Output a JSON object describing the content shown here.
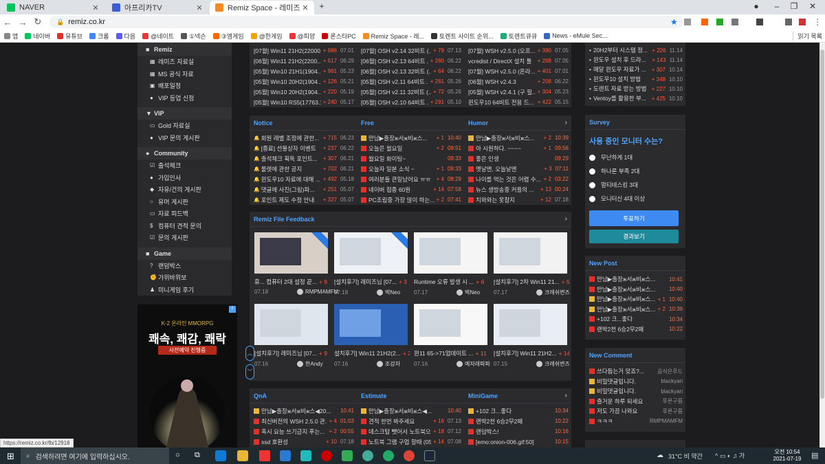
{
  "browser": {
    "tabs": [
      {
        "title": "NAVER",
        "color": "#03c75a"
      },
      {
        "title": "아프리카TV",
        "color": "#3b5ed8"
      },
      {
        "title": "Remiz Space - 레미즈",
        "color": "#f28b20"
      }
    ],
    "url": "remiz.co.kr",
    "bookmarks": [
      {
        "label": "앱",
        "color": "#888"
      },
      {
        "label": "네이버",
        "color": "#03c75a"
      },
      {
        "label": "유튜브",
        "color": "#e52d27"
      },
      {
        "label": "크롬",
        "color": "#4285f4"
      },
      {
        "label": "다음",
        "color": "#5a5aff"
      },
      {
        "label": "@네이트",
        "color": "#e33"
      },
      {
        "label": "①넥슨",
        "color": "#555"
      },
      {
        "label": "③엠게임",
        "color": "#f60"
      },
      {
        "label": "@한게임",
        "color": "#f4a300"
      },
      {
        "label": "@피망",
        "color": "#e33"
      },
      {
        "label": "론스타PC",
        "color": "#c00"
      },
      {
        "label": "Remiz Space - 레...",
        "color": "#f28b20"
      },
      {
        "label": "토렌트 사이트 순위...",
        "color": "#333"
      },
      {
        "label": "토렌트큐큐",
        "color": "#2a7"
      },
      {
        "label": "News - eMule Sec...",
        "color": "#36c"
      }
    ],
    "reading_list": "읽기 목록",
    "status_url": "https://remiz.co.kr/fb/12918"
  },
  "sidebar": {
    "sections": [
      {
        "title": "Remiz",
        "icon": "■",
        "items": [
          {
            "label": "레미즈 자료실",
            "icon": "▦"
          },
          {
            "label": "MS 공식 자료",
            "icon": "▦"
          },
          {
            "label": "배포일정",
            "icon": "▣"
          },
          {
            "label": "VIP 등업 신청",
            "icon": "●"
          }
        ]
      },
      {
        "title": "VIP",
        "icon": "▼",
        "items": [
          {
            "label": "Gold 자료실",
            "icon": "▭"
          },
          {
            "label": "VIP 문의 게시판",
            "icon": "●"
          }
        ]
      },
      {
        "title": "Community",
        "icon": "●",
        "items": [
          {
            "label": "출석체크",
            "icon": "☑"
          },
          {
            "label": "가입인사",
            "icon": "●"
          },
          {
            "label": "자유/건의 게시판",
            "icon": "◆"
          },
          {
            "label": "유머 게시판",
            "icon": "○"
          },
          {
            "label": "자료 피드백",
            "icon": "▭"
          },
          {
            "label": "컴퓨터 견적 문의",
            "icon": "$"
          },
          {
            "label": "문의 게시판",
            "icon": "☑"
          }
        ]
      },
      {
        "title": "Game",
        "icon": "■",
        "items": [
          {
            "label": "랜덤박스",
            "icon": "?"
          },
          {
            "label": "가위바위보",
            "icon": "✊"
          },
          {
            "label": "미니게임 후기",
            "icon": "♟"
          }
        ]
      }
    ]
  },
  "ad": {
    "game": "K-2 온라인 MMORPG",
    "slogan": "쾌속, 쾌감, 쾌락",
    "cta": "사전예약 진행중"
  },
  "top_lists": {
    "col1": [
      {
        "t": "[07월] Win11 21H2(22000...",
        "c": "+ 986",
        "d": "07.01"
      },
      {
        "t": "[06월] Win11 21H2(2200...",
        "c": "+ 617",
        "d": "06.29"
      },
      {
        "t": "[05월] Win10 21H1(1904...",
        "c": "+ 961",
        "d": "05.23"
      },
      {
        "t": "[05월] Win10 20H2(1904...",
        "c": "+ 126",
        "d": "05.21"
      },
      {
        "t": "[05월] Win10 20H2(1904...",
        "c": "+ 220",
        "d": "05.19"
      },
      {
        "t": "[05월] Win10 RS5(17763.1...",
        "c": "+ 240",
        "d": "05.17"
      }
    ],
    "col2": [
      {
        "t": "[07월] OSH v2.14 32비트 (...",
        "c": "+ 79",
        "d": "07.13"
      },
      {
        "t": "[06월] OSH v2.13 64비트 ...",
        "c": "+ 260",
        "d": "06.22"
      },
      {
        "t": "[06월] OSH v2.13 32비트 (...",
        "c": "+ 64",
        "d": "06.22"
      },
      {
        "t": "[05월] OSH v2.11 64비트 ...",
        "c": "+ 261",
        "d": "05.26"
      },
      {
        "t": "[05월] OSH v2.11 32비트 (...",
        "c": "+ 72",
        "d": "05.26"
      },
      {
        "t": "[05월] OSH v2.10 64비트 ...",
        "c": "+ 291",
        "d": "05.10"
      }
    ],
    "col3": [
      {
        "t": "[07월] WSH v2.5.0 (오프...",
        "c": "+ 390",
        "d": "07.05"
      },
      {
        "t": "vcredist / DirectX 설치 툴",
        "c": "+ 268",
        "d": "07.05"
      },
      {
        "t": "[07월] WSH v2.5.0 (온라...",
        "c": "+ 401",
        "d": "07.01"
      },
      {
        "t": "[06월] WSH v2.4.3",
        "c": "+ 208",
        "d": "06.22"
      },
      {
        "t": "[05월] WSH v2.4.1 (구 필...",
        "c": "+ 304",
        "d": "05.23"
      },
      {
        "t": "윈도우10 64비트 전용 드...",
        "c": "+ 422",
        "d": "05.15"
      }
    ]
  },
  "notice": {
    "title": "Notice",
    "items": [
      {
        "t": "회원 레벨 조정에 관한...",
        "c": "+ 715",
        "d": "06.23"
      },
      {
        "t": "[종료] 선물상자 이벤트",
        "c": "+ 237",
        "d": "06.22"
      },
      {
        "t": "출석체크 획득 포인트...",
        "c": "+ 307",
        "d": "06.21"
      },
      {
        "t": "룰렛에 관한 공지",
        "c": "+ 702",
        "d": "06.21"
      },
      {
        "t": "윈도우10 자료에 대해 ...",
        "c": "+ 492",
        "d": "05.18"
      },
      {
        "t": "댓글에 사진(그림)파...",
        "c": "+ 251",
        "d": "05.07"
      },
      {
        "t": "포인트 제도 수정 안내",
        "c": "+ 327",
        "d": "05.07"
      }
    ]
  },
  "free": {
    "title": "Free",
    "items": [
      {
        "t": "만남▶출장ж서ж비ж스...",
        "c": "+ 1",
        "d": "10:40"
      },
      {
        "t": "오늘은 월요일",
        "c": "+ 2",
        "d": "09:51"
      },
      {
        "t": "월요일 화이팅~",
        "c": "",
        "d": "09:33"
      },
      {
        "t": "오늘자 일본 소식 ~",
        "c": "+ 1",
        "d": "09:33"
      },
      {
        "t": "여러분들 큰일났어요 ㅠㅠ",
        "c": "+ 4",
        "d": "08:29"
      },
      {
        "t": "네이버 접종 60원",
        "c": "+ 14",
        "d": "07:58"
      },
      {
        "t": "PC조립중 가장 많이 하는...",
        "c": "+ 2",
        "d": "07:41"
      }
    ]
  },
  "humor": {
    "title": "Humor",
    "items": [
      {
        "t": "만남▶출장ж서ж비ж스...",
        "c": "+ 2",
        "d": "10:39"
      },
      {
        "t": "아 시원하다. ~~~~",
        "c": "+ 1",
        "d": "09:56"
      },
      {
        "t": "좋은 인생",
        "c": "",
        "d": "09:29"
      },
      {
        "t": "옛날엔, 오늘날엔",
        "c": "+ 3",
        "d": "07:11"
      },
      {
        "t": "나이를 먹는 것은 어렵 수...",
        "c": "+ 2",
        "d": "03:22"
      },
      {
        "t": "뉴스 생방송중 커플의 ...",
        "c": "+ 13",
        "d": "00:24"
      },
      {
        "t": "치와와는 못참지",
        "c": "+ 12",
        "d": "07.18"
      }
    ]
  },
  "feedback": {
    "title": "Remiz File Feedback",
    "items": [
      {
        "cap": "휴... 컴퓨터 2대 설정 끝...",
        "c": "+ 9",
        "d": "07.18",
        "user": "RMPMAMFM"
      },
      {
        "cap": "[설치후기] 레미즈님 [07...",
        "c": "+ 3",
        "d": "07.18",
        "user": "벽Neo"
      },
      {
        "cap": "Runtime 오류 발생 시 ...",
        "c": "+ 6",
        "d": "07.17",
        "user": "벽Neo"
      },
      {
        "cap": "[설치후기] 2차 Win11 21...",
        "c": "+ 5",
        "d": "07.17",
        "user": "크레쉬변즈"
      },
      {
        "cap": "[설치후기] 레미즈님 [07...",
        "c": "+ 9",
        "d": "07.16",
        "user": "한Andy"
      },
      {
        "cap": "설치후기] Win11 21H2(2...",
        "c": "+ 2",
        "d": "07.16",
        "user": "조강자"
      },
      {
        "cap": "윈11 65->71업데이트 ...",
        "c": "+ 11",
        "d": "07.16",
        "user": "예자래파파"
      },
      {
        "cap": "[설치후기] Win11 21H2...",
        "c": "+ 14",
        "d": "07.15",
        "user": "크레쉬변즈"
      }
    ]
  },
  "qna": {
    "title": "QnA",
    "items": [
      {
        "t": "만남▶출장ж서ж비ж스◀20...",
        "c": "",
        "d": "10:41"
      },
      {
        "t": "최신버전의 WSH 2.5.0 관...",
        "c": "+ 4",
        "d": "01:03"
      },
      {
        "t": "혹시 요능 쓰기금지 푸는...",
        "c": "+ 2",
        "d": "00:55"
      },
      {
        "t": "ssd 호환성",
        "c": "+ 10",
        "d": "07.18"
      }
    ]
  },
  "estimate": {
    "title": "Estimate",
    "items": [
      {
        "t": "만남▶출장ж서ж비ж스◀...",
        "c": "",
        "d": "10:40"
      },
      {
        "t": "견적 한번 봐주세요",
        "c": "+ 16",
        "d": "07.13"
      },
      {
        "t": "데스크탑 뺏어서 노트북으...",
        "c": "+ 18",
        "d": "07.12"
      },
      {
        "t": "노트북 그램 구업 할때 (05...",
        "c": "+ 14",
        "d": "07.08"
      }
    ]
  },
  "minigame": {
    "title": "MiniGame",
    "items": [
      {
        "t": "+102 크...좋다",
        "c": "",
        "d": "10:34"
      },
      {
        "t": "랜박2천 6승2무2패",
        "c": "",
        "d": "10:22"
      },
      {
        "t": "랜덤박스!",
        "c": "",
        "d": "10:16"
      },
      {
        "t": "[emo:onion-006.gif:50]",
        "c": "",
        "d": "10:15"
      }
    ]
  },
  "right_top": {
    "items": [
      {
        "t": "20H2부터 시스템 정...",
        "c": "+ 226",
        "d": "11.14"
      },
      {
        "t": "윈도우 설치 후 드라...",
        "c": "+ 143",
        "d": "11.14"
      },
      {
        "t": "매달 윈도우 자료가 ...",
        "c": "+ 307",
        "d": "10.14"
      },
      {
        "t": "윈도우10 설치 방법",
        "c": "+ 348",
        "d": "10.10"
      },
      {
        "t": "도렌트 자료 받는 방법",
        "c": "+ 227",
        "d": "10.10"
      },
      {
        "t": "Ventoy를 활용한 부...",
        "c": "+ 425",
        "d": "10.10"
      }
    ]
  },
  "survey": {
    "title": "Survey",
    "question": "사용 중인 모니터 수는?",
    "options": [
      "무난하게 1대",
      "하나론 부족 2대",
      "멀티테스킹 3대",
      "모니터신 4대 이상"
    ],
    "vote": "투표하기",
    "result": "결과보기"
  },
  "newpost": {
    "title": "New Post",
    "items": [
      {
        "t": "만남▶출장ж서ж비ж스...",
        "c": "",
        "d": "10:41",
        "k": "r"
      },
      {
        "t": "만남▶출장ж서ж비ж스...",
        "c": "",
        "d": "10:40",
        "k": "r"
      },
      {
        "t": "만남▶출장ж서ж비ж스...",
        "c": "+ 1",
        "d": "10:40",
        "k": "y"
      },
      {
        "t": "만남▶출장ж서ж비ж스...",
        "c": "+ 2",
        "d": "10:39",
        "k": "y"
      },
      {
        "t": "+102 크...좋다",
        "c": "",
        "d": "10:34",
        "k": "r"
      },
      {
        "t": "랜박2천 6승2무2패",
        "c": "",
        "d": "10:22",
        "k": "r"
      }
    ]
  },
  "newcomment": {
    "title": "New Comment",
    "items": [
      {
        "t": "쓰다듬는거 맞죠?...",
        "d": "음식은푸드",
        "k": "r"
      },
      {
        "t": "비밀댓글입니다.",
        "d": "blackyari",
        "k": "y"
      },
      {
        "t": "비밀댓글입니다.",
        "d": "blackyari",
        "k": "y"
      },
      {
        "t": "즐거운 하루 되세요",
        "d": "푸른구름",
        "k": "r"
      },
      {
        "t": "저도 가끔 나와요",
        "d": "푸른구름",
        "k": "r"
      },
      {
        "t": "ㅋㅋㅋ",
        "d": "RMPMAMFM",
        "k": "r"
      }
    ]
  },
  "taskbar": {
    "search_placeholder": "검색하려면 여기에 입력하십시오.",
    "weather": "31°C 비 약간",
    "time": "오전 10:54",
    "date": "2021-07-19"
  }
}
